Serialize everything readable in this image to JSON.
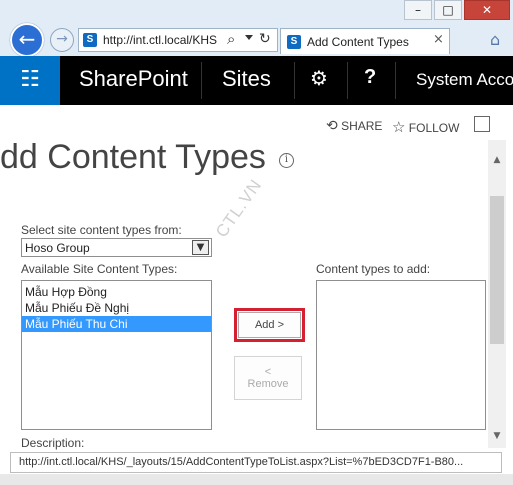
{
  "window": {
    "minimize": "–",
    "maximize": "□",
    "close": "✕"
  },
  "browser": {
    "back_icon": "back-arrow-icon",
    "forward_icon": "forward-arrow-icon",
    "address": "http://int.ctl.local/KHS",
    "search_glyph": "⌕",
    "refresh_glyph": "↻",
    "tab_title": "Add Content Types",
    "tab_close": "×",
    "home_glyph": "⌂",
    "site_icon_letter": "S"
  },
  "suite_bar": {
    "waffle_glyph": "☷",
    "brand": "SharePoint",
    "sites": "Sites",
    "gear_glyph": "⚙",
    "help": "?",
    "account": "System Account"
  },
  "actions": {
    "share": "SHARE",
    "follow": "FOLLOW",
    "share_glyph": "⟲",
    "follow_glyph": "☆"
  },
  "page": {
    "title": "dd Content Types",
    "info": "i",
    "watermark": "CTL.VN",
    "select_label": "Select site content types from:",
    "select_value": "Hoso Group",
    "available_label": "Available Site Content Types:",
    "available_items": [
      "Mẫu Hợp Đồng",
      "Mẫu Phiếu Đề Nghị",
      "Mẫu Phiếu Thu Chi"
    ],
    "selected_index": 2,
    "to_add_label": "Content types to add:",
    "add_button": "Add >",
    "remove_arrow": "<",
    "remove_button": "Remove",
    "description_label": "Description:"
  },
  "status_bar": {
    "url": "http://int.ctl.local/KHS/_layouts/15/AddContentTypeToList.aspx?List=%7bED3CD7F1-B80..."
  },
  "colors": {
    "suite_bg": "#000000",
    "waffle_bg": "#0072c6",
    "highlight_border": "#d42031",
    "selection": "#3399ff"
  }
}
